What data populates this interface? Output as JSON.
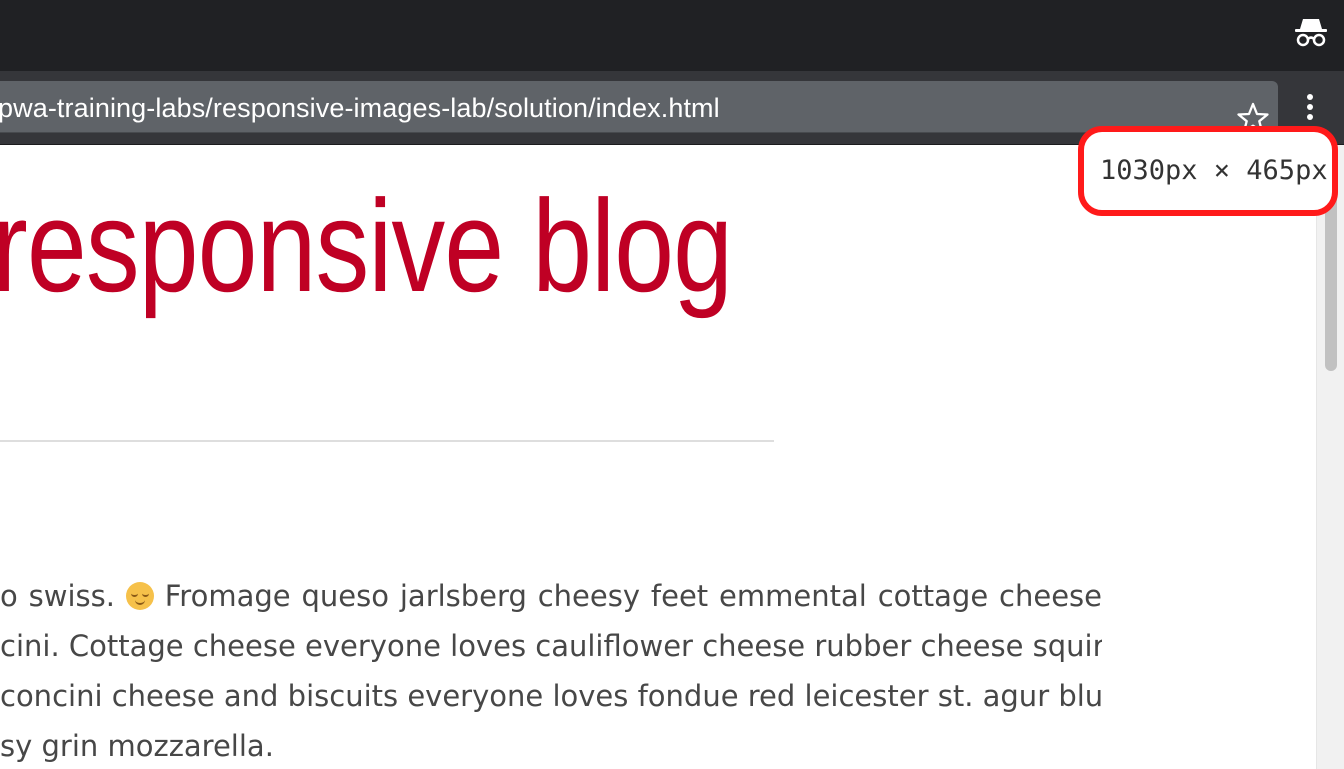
{
  "browser": {
    "url": "pwa-training-labs/responsive-images-lab/solution/index.html",
    "icons": {
      "incognito": "incognito-icon",
      "bookmark": "star-icon",
      "menu": "more-vertical-icon"
    }
  },
  "page": {
    "title": "responsive blog",
    "article_lines": [
      {
        "before": "o swiss. ",
        "emoji": "smiling-face-emoji",
        "after": " Fromage queso jarlsberg cheesy feet emmental cottage cheese"
      },
      {
        "text": "cini. Cottage cheese everyone loves cauliflower cheese rubber cheese squirty"
      },
      {
        "text": "concini cheese and biscuits everyone loves fondue red leicester st. agur blue"
      },
      {
        "text": "sy grin mozzarella."
      }
    ]
  },
  "viewport_size_label": "1030px × 465px",
  "colors": {
    "title": "#bf0024",
    "highlight": "#ff1a1a",
    "titlebar": "#202124",
    "omnibox": "#5f6368"
  }
}
